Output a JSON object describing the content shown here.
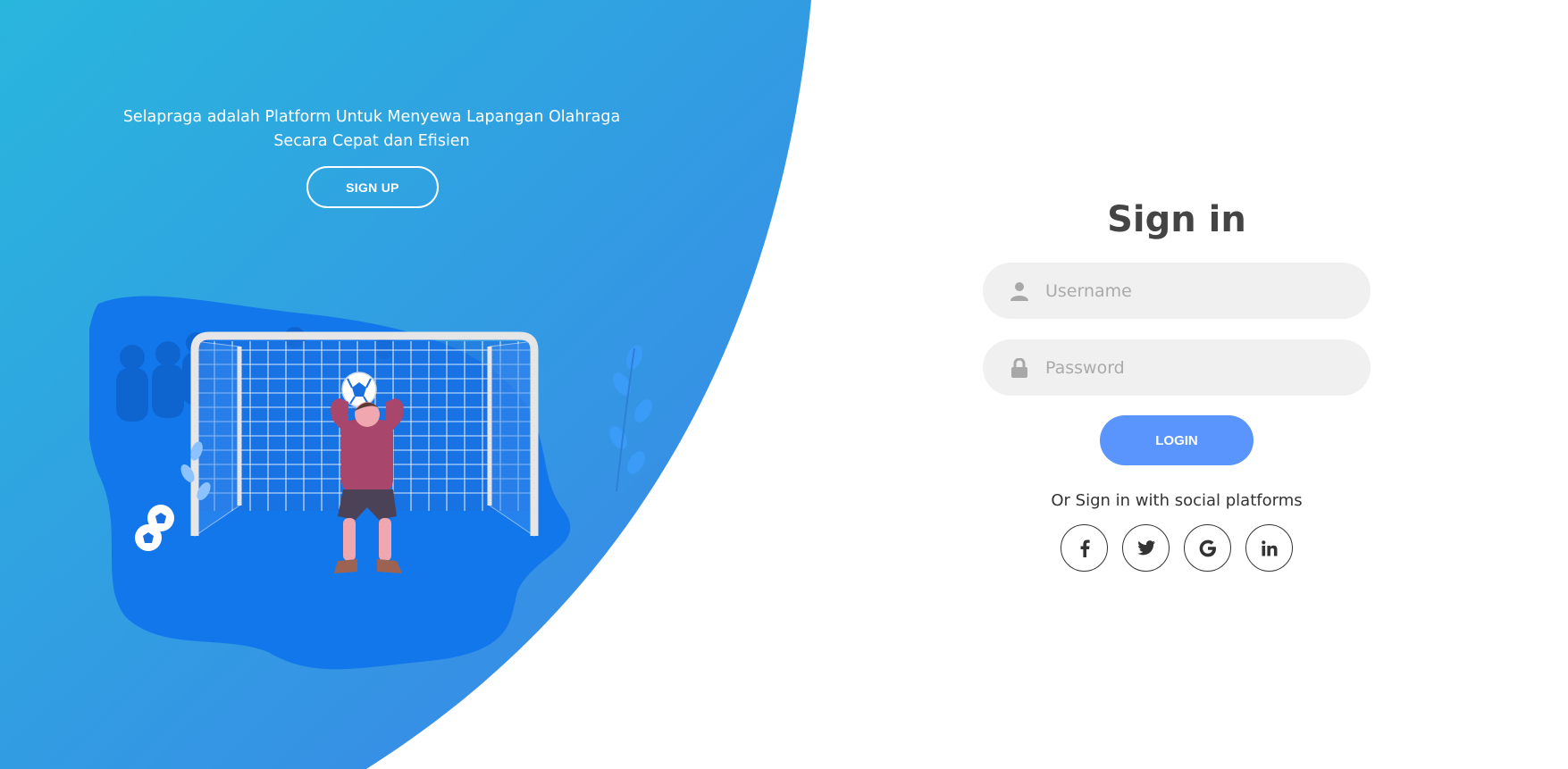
{
  "hero": {
    "tagline_line1": "Selapraga adalah Platform Untuk Menyewa Lapangan Olahraga",
    "tagline_line2": "Secara Cepat dan Efisien",
    "signup_label": "SIGN UP"
  },
  "signin": {
    "title": "Sign in",
    "username_placeholder": "Username",
    "password_placeholder": "Password",
    "login_label": "LOGIN",
    "social_text": "Or Sign in with social platforms",
    "social": [
      {
        "name": "facebook-icon"
      },
      {
        "name": "twitter-icon"
      },
      {
        "name": "google-icon"
      },
      {
        "name": "linkedin-icon"
      }
    ]
  },
  "colors": {
    "panel_gradient_start": "#29b6dd",
    "panel_gradient_end": "#3b82e8",
    "accent": "#5995fd",
    "input_bg": "#f0f0f0",
    "title": "#444444"
  },
  "illustration": {
    "subject": "goalkeeper-illustration"
  }
}
